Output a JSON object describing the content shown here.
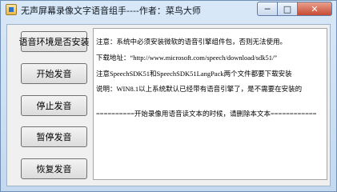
{
  "window": {
    "title": "无声屏幕录像文字语音组手----作者：菜鸟大师",
    "controls": {
      "minimize": "─",
      "maximize": "□",
      "close": "✕"
    }
  },
  "buttons": {
    "check_env": "语音环境是否安装",
    "start": "开始发音",
    "stop": "停止发音",
    "pause": "暂停发音",
    "resume": "恢复发音"
  },
  "textbox": {
    "lines": [
      "注意：系统中必须安装微软的语音引擎组件包，否则无法使用。",
      "下载地址：“http://www.microsoft.com/speech/download/sdk51/”",
      "注意SpeechSDK51和SpeechSDK51LangPack两个文件都要下载安装",
      "说明：WIN8.1以上系统默认已经带有语音引擎了，是不需要在安装的",
      "==========开始录像用语音读文本的时候，请删除本文本============"
    ]
  }
}
